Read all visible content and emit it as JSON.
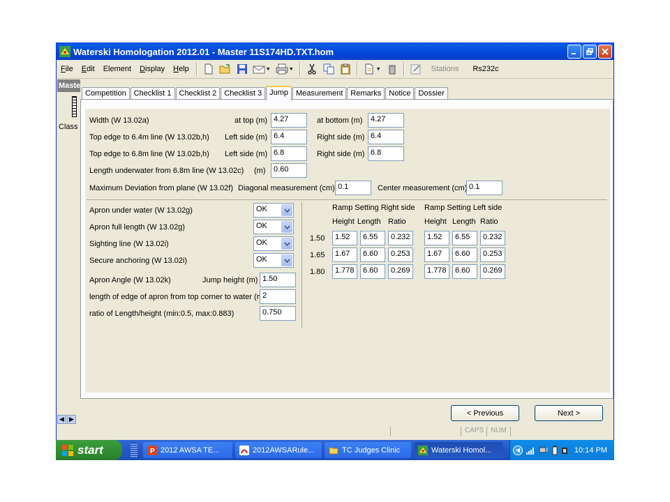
{
  "window": {
    "title": "Waterski Homologation 2012.01 - Master 11S174HD.TXT.hom"
  },
  "menu": [
    {
      "label": "File",
      "ul": "F",
      "rest": "ile"
    },
    {
      "label": "Edit",
      "ul": "E",
      "rest": "dit"
    },
    {
      "label": "Element",
      "ul": "",
      "rest": "Element"
    },
    {
      "label": "Display",
      "ul": "D",
      "rest": "isplay"
    },
    {
      "label": "Help",
      "ul": "H",
      "rest": "elp"
    }
  ],
  "toolbar": {
    "stations": "Stations",
    "rs232c": "Rs232c"
  },
  "left": {
    "header": "Master",
    "class_label": "Class"
  },
  "tabs": [
    "Competition",
    "Checklist 1",
    "Checklist 2",
    "Checklist 3",
    "Jump",
    "Measurement",
    "Remarks",
    "Notice",
    "Dossier"
  ],
  "jump": {
    "width_label": "Width (W 13.02a)",
    "at_top_label": "at top (m)",
    "at_top_value": "4.27",
    "at_bottom_label": "at bottom (m)",
    "at_bottom_value": "4.27",
    "edge64_label": "Top edge to 6.4m line (W 13.02b,h)",
    "edge64_left_label": "Left side (m)",
    "edge64_left_value": "6.4",
    "edge64_right_label": "Right side (m)",
    "edge64_right_value": "6.4",
    "edge68_label": "Top edge to 6.8m line (W 13.02b,h)",
    "edge68_left_label": "Left side (m)",
    "edge68_left_value": "6.8",
    "edge68_right_label": "Right side (m)",
    "edge68_right_value": "6.8",
    "underwater_label": "Length underwater from 6.8m line (W 13.02c)",
    "underwater_unit": "(m)",
    "underwater_value": "0.60",
    "deviation_label": "Maximum Deviation from plane (W 13.02f)",
    "diagonal_label": "Diagonal measurement (cm)",
    "diagonal_value": "0.1",
    "center_label": "Center measurement (cm)",
    "center_value": "0.1",
    "apron_under_label": "Apron under water (W 13.02g)",
    "apron_under_value": "OK",
    "apron_full_label": "Apron full length (W 13.02g)",
    "apron_full_value": "OK",
    "sighting_label": "Sighting line (W 13.02i)",
    "sighting_value": "OK",
    "anchoring_label": "Secure anchoring (W 13.02i)",
    "anchoring_value": "OK",
    "apron_angle_label": "Apron Angle  (W 13.02k)",
    "jump_height_label": "Jump height (m)",
    "jump_height_value": "1.50",
    "edge_length_label": "length of edge of apron from top corner to water (m)",
    "edge_length_value": "2",
    "ratio_label": "ratio of Length/height (min:0.5, max:0.883)",
    "ratio_value": "0.750"
  },
  "ramp": {
    "right_title": "Ramp Setting Right side",
    "left_title": "Ramp Setting Left side",
    "col_height": "Height",
    "col_length": "Length",
    "col_ratio": "Ratio",
    "rows": [
      {
        "setting": "1.50",
        "right": [
          "1.52",
          "6.55",
          "0.232"
        ],
        "left": [
          "1.52",
          "6.55",
          "0.232"
        ]
      },
      {
        "setting": "1.65",
        "right": [
          "1.67",
          "6.60",
          "0.253"
        ],
        "left": [
          "1.67",
          "6.60",
          "0.253"
        ]
      },
      {
        "setting": "1.80",
        "right": [
          "1.778",
          "6.60",
          "0.269"
        ],
        "left": [
          "1.778",
          "6.60",
          "0.269"
        ]
      }
    ]
  },
  "buttons": {
    "previous": "< Previous",
    "next": "Next >"
  },
  "status": {
    "caps": "CAPS",
    "num": "NUM"
  },
  "taskbar": {
    "start": "start",
    "items": [
      "2012 AWSA TE...",
      "2012AWSARule...",
      "TC Judges Clinic",
      "Waterski Homol..."
    ],
    "clock": "10:14 PM"
  }
}
